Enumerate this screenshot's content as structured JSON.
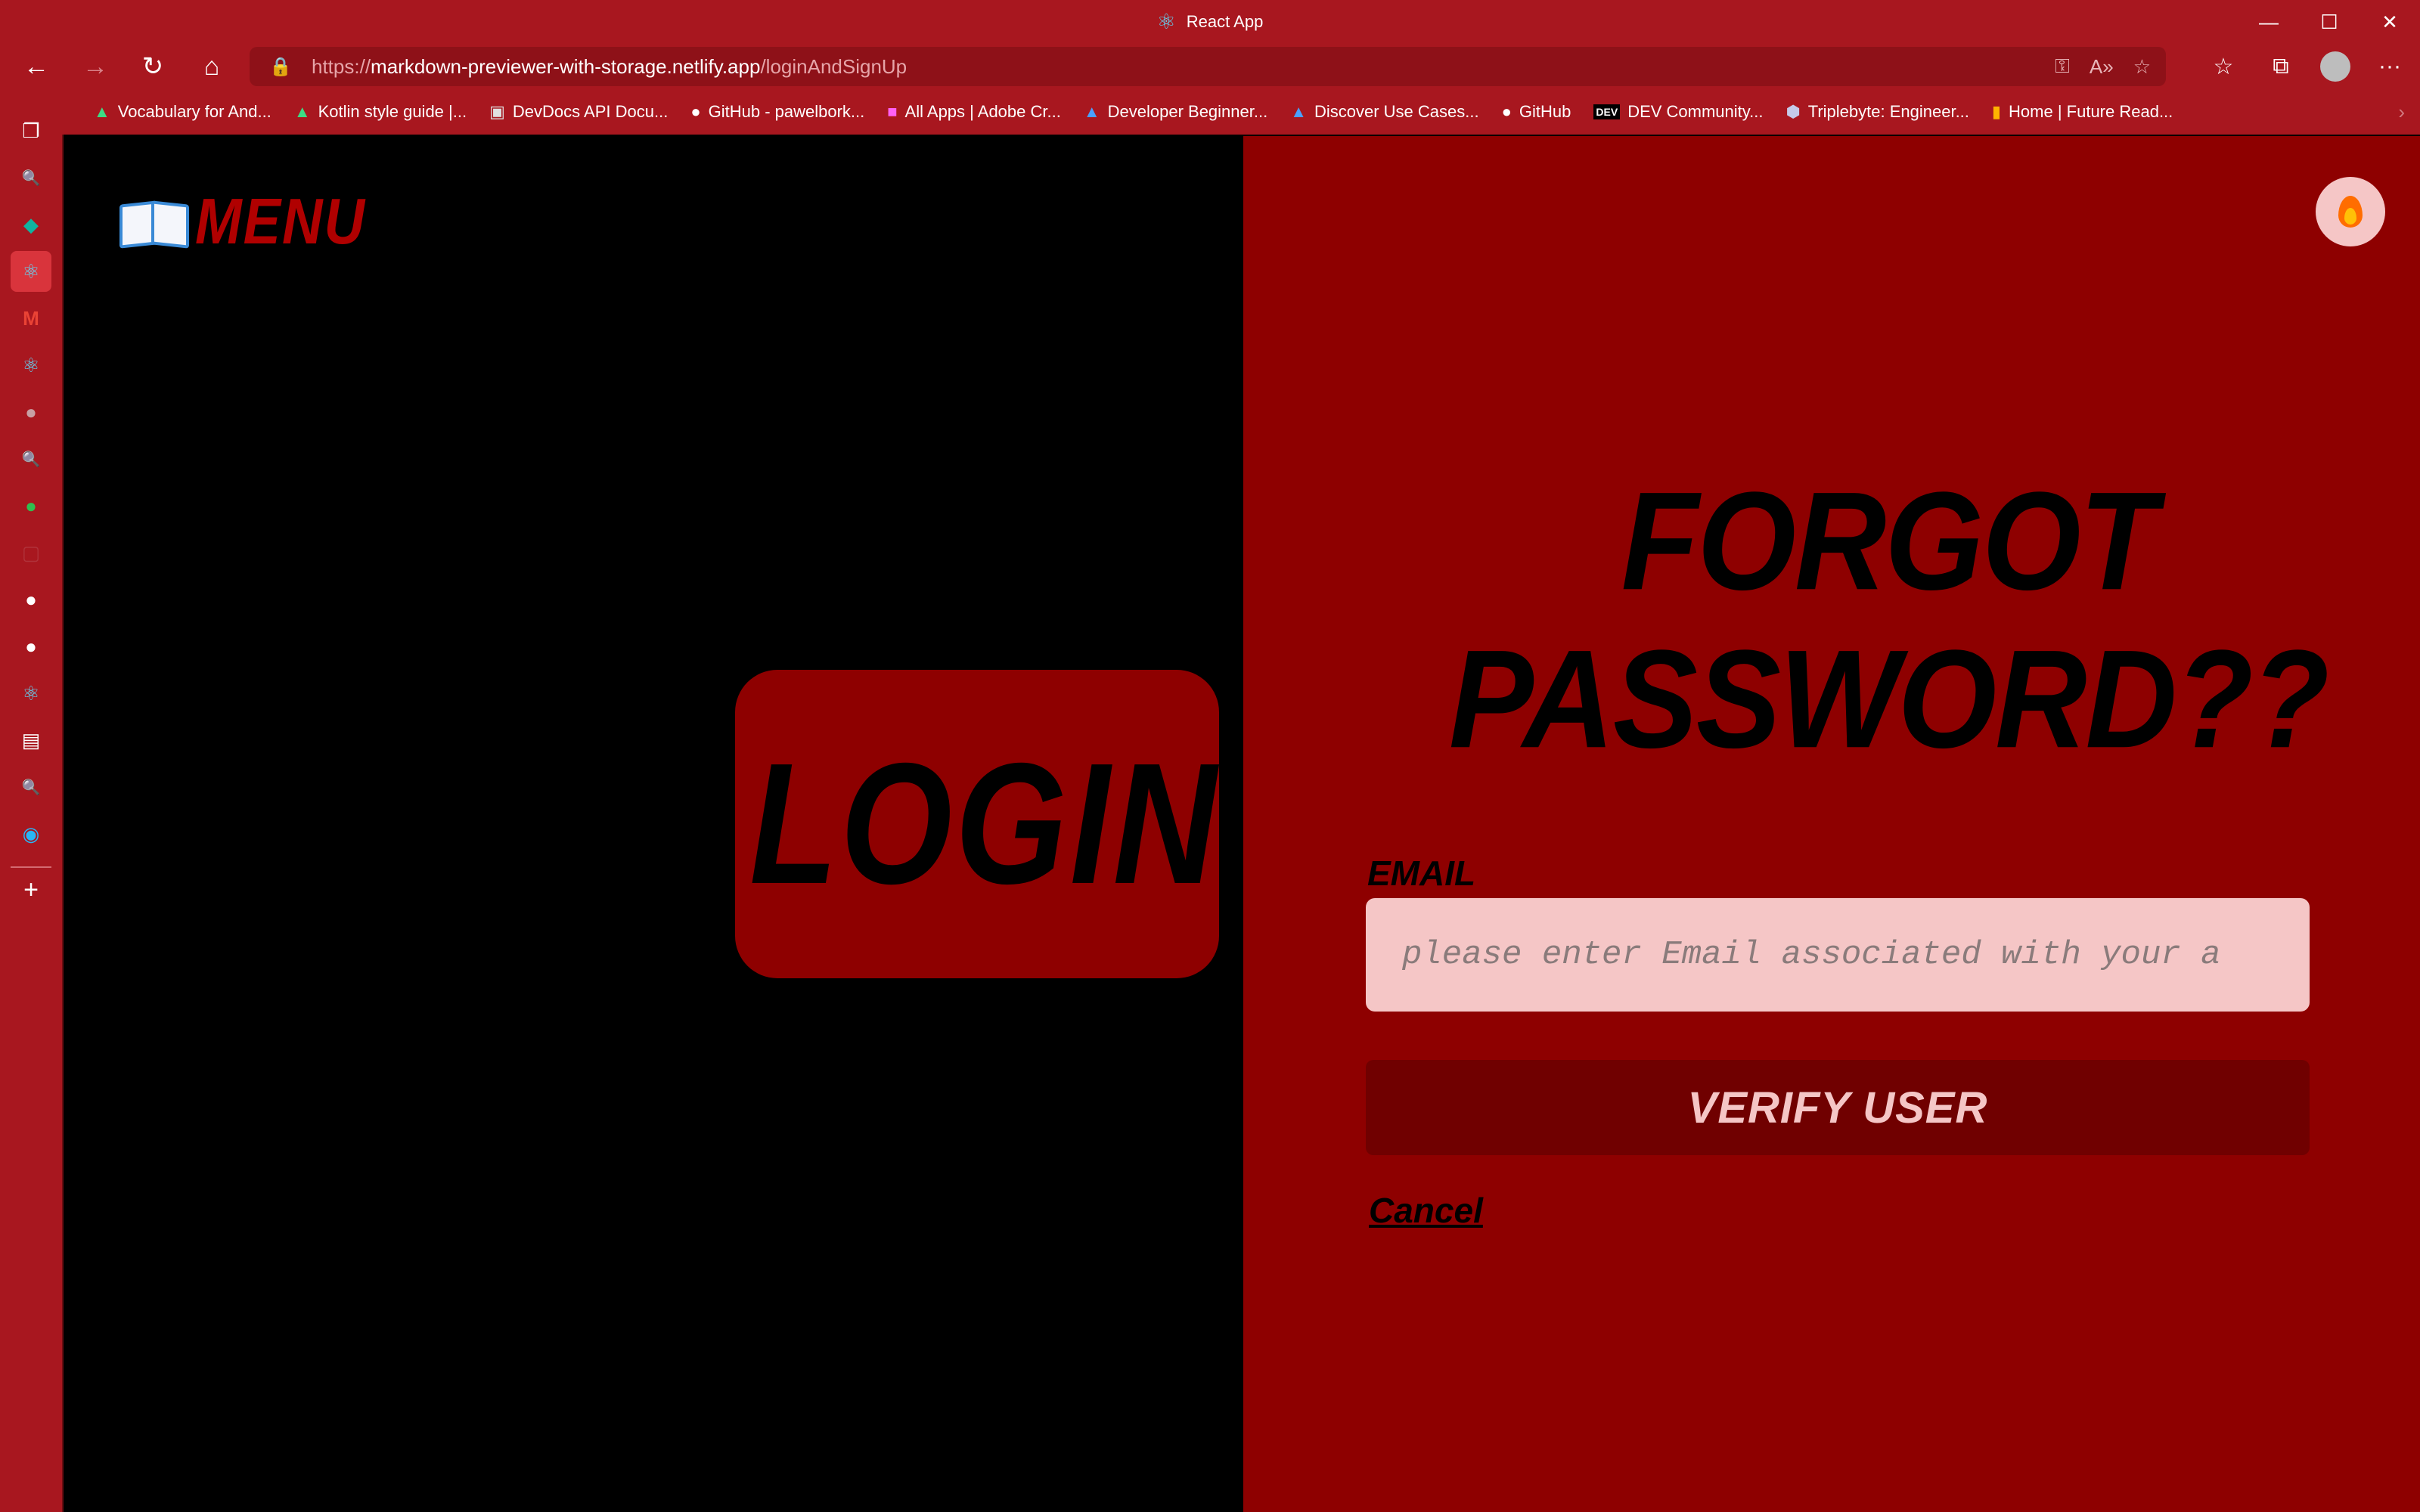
{
  "window": {
    "title": "React App",
    "controls": {
      "minimize": "—",
      "maximize": "☐",
      "close": "✕"
    }
  },
  "address": {
    "scheme": "https://",
    "host": "markdown-previewer-with-storage.netlify.app",
    "path": "/loginAndSignUp"
  },
  "bookmarks": [
    {
      "label": "Vocabulary for And...",
      "icon": "android-icon",
      "color": "#3ddc84"
    },
    {
      "label": "Kotlin style guide |...",
      "icon": "android-icon",
      "color": "#3ddc84"
    },
    {
      "label": "DevDocs API Docu...",
      "icon": "devdocs-icon",
      "color": "#e0e0e0"
    },
    {
      "label": "GitHub - pawelbork...",
      "icon": "github-icon",
      "color": "#ffffff"
    },
    {
      "label": "All Apps | Adobe Cr...",
      "icon": "adobe-icon",
      "color": "#ff61f6"
    },
    {
      "label": "Developer Beginner...",
      "icon": "azure-icon",
      "color": "#4aa0ff"
    },
    {
      "label": "Discover Use Cases...",
      "icon": "azure-icon",
      "color": "#4aa0ff"
    },
    {
      "label": "GitHub",
      "icon": "github-icon",
      "color": "#ffffff"
    },
    {
      "label": "DEV Community...",
      "icon": "dev-icon",
      "color": "#000000"
    },
    {
      "label": "Triplebyte: Engineer...",
      "icon": "triplebyte-icon",
      "color": "#1a237e"
    },
    {
      "label": "Home | Future Read...",
      "icon": "futureread-icon",
      "color": "#ffb300"
    }
  ],
  "page": {
    "menu_label": "MENU",
    "login_label": "LOGIN",
    "forgot_title_line1": "FORGOT",
    "forgot_title_line2": "PASSWORD??",
    "email_label": "EMAIL",
    "email_placeholder": "please enter Email associated with your a",
    "email_value": "",
    "verify_label": "VERIFY USER",
    "cancel_label": "Cancel"
  },
  "colors": {
    "chrome": "#a8171f",
    "right_panel": "#8e0000",
    "left_panel": "#000000",
    "input_bg": "#f5c6c6",
    "button_bg": "#700000"
  }
}
